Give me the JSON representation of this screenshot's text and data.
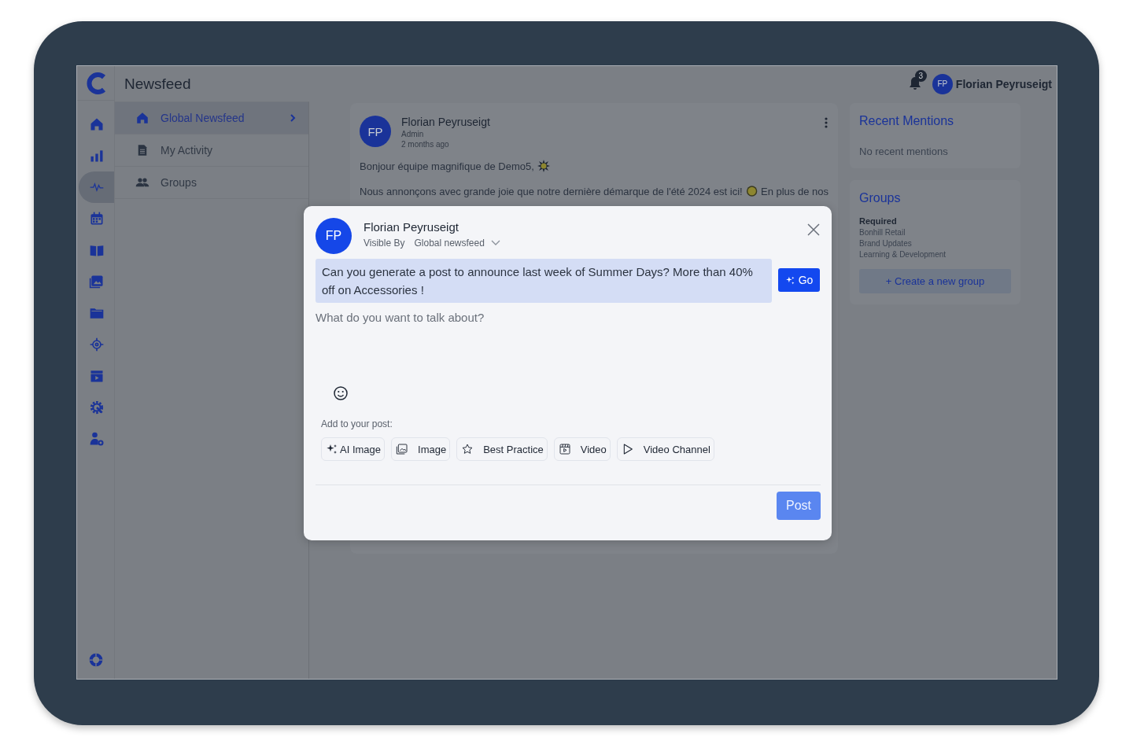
{
  "header": {
    "title": "Newsfeed",
    "notification_count": "3",
    "user": {
      "initials": "FP",
      "name": "Florian Peyruseigt"
    }
  },
  "rail": {
    "items": [
      {
        "selected": false
      },
      {
        "selected": false
      },
      {
        "selected": true
      },
      {
        "selected": false
      },
      {
        "selected": false
      },
      {
        "selected": false
      },
      {
        "selected": false
      },
      {
        "selected": false
      },
      {
        "selected": false
      },
      {
        "selected": false
      },
      {
        "selected": false
      }
    ]
  },
  "subnav": [
    {
      "label": "Global Newsfeed",
      "selected": true
    },
    {
      "label": "My Activity",
      "selected": false
    },
    {
      "label": "Groups",
      "selected": false
    }
  ],
  "post": {
    "initials": "FP",
    "author": "Florian Peyruseigt",
    "role": "Admin",
    "time": "2 months ago",
    "greeting": "Bonjour équipe magnifique de Demo5,",
    "announcement": "Nous annonçons avec grande joie que notre dernière démarque de l'été 2024 est ici!",
    "announcement_rest": "En plus de nos"
  },
  "mentions": {
    "title": "Recent Mentions",
    "empty": "No recent mentions"
  },
  "groups": {
    "title": "Groups",
    "section": "Required",
    "items": [
      "Bonhill Retail",
      "Brand Updates",
      "Learning & Development"
    ],
    "create_button": "+ Create a new group"
  },
  "composer": {
    "initials": "FP",
    "name": "Florian Peyruseigt",
    "visible_label": "Visible By",
    "visibility": "Global newsfeed",
    "prompt": "Can you generate a post to announce last week of Summer Days? More than 40% off on Accessories !",
    "go_button": "Go",
    "placeholder": "What do you want to talk about?",
    "add_label": "Add to your post:",
    "attachments": [
      {
        "label": "AI Image"
      },
      {
        "label": "Image"
      },
      {
        "label": "Best Practice"
      },
      {
        "label": "Video"
      },
      {
        "label": "Video Channel"
      }
    ],
    "post_button": {
      "label": "Post",
      "disabled": true
    }
  }
}
